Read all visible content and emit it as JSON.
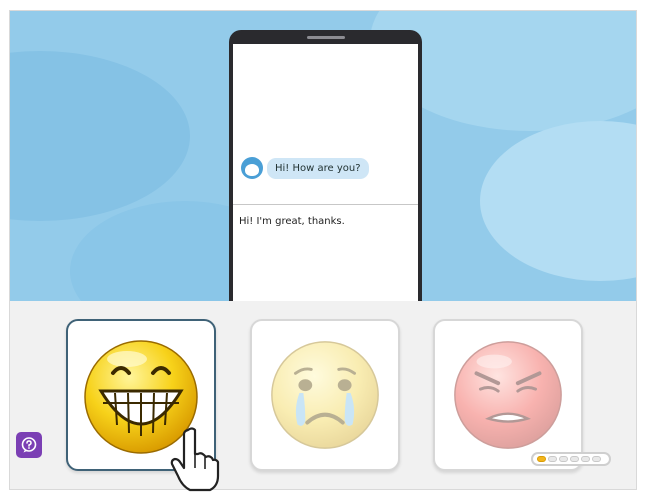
{
  "scene": {
    "incoming_message": "Hi! How are you?",
    "reply_message": "Hi! I'm great, thanks."
  },
  "choices": [
    {
      "emotion": "happy",
      "icon": "grinning-face-icon",
      "selected": true
    },
    {
      "emotion": "sad",
      "icon": "crying-face-icon",
      "selected": false
    },
    {
      "emotion": "angry",
      "icon": "angry-face-icon",
      "selected": false
    }
  ],
  "help": {
    "icon": "question-bubble-icon"
  },
  "progress": {
    "completed": 1,
    "total": 6
  },
  "cursor": {
    "icon": "pointing-hand-icon"
  },
  "colors": {
    "sky": "#93cbea",
    "selected_border": "#3f6277",
    "help_button": "#7b3fb4",
    "progress_fill": "#f3b51c"
  }
}
